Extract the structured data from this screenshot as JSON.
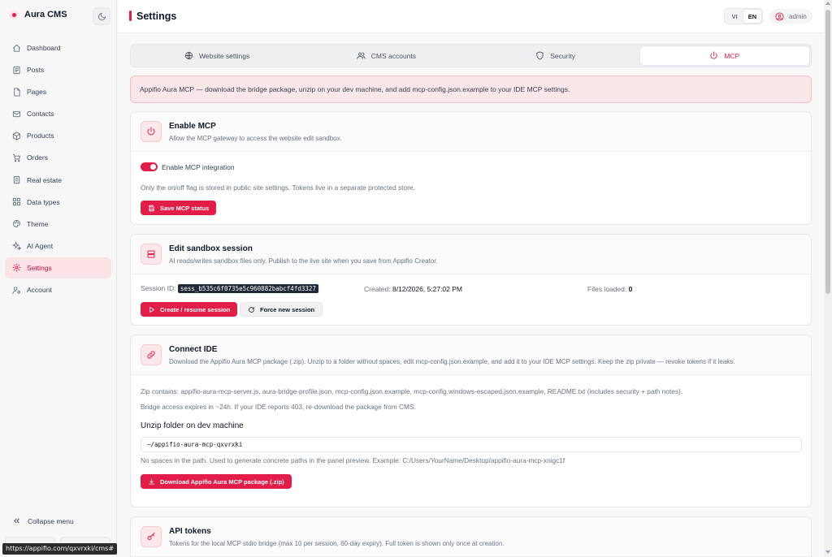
{
  "app": {
    "name": "Aura CMS"
  },
  "sidebar": {
    "items": [
      {
        "label": "Dashboard",
        "icon": "home-icon"
      },
      {
        "label": "Posts",
        "icon": "document-icon"
      },
      {
        "label": "Pages",
        "icon": "pages-icon"
      },
      {
        "label": "Contacts",
        "icon": "mail-icon"
      },
      {
        "label": "Products",
        "icon": "box-icon"
      },
      {
        "label": "Orders",
        "icon": "cart-icon"
      },
      {
        "label": "Real estate",
        "icon": "building-icon"
      },
      {
        "label": "Data types",
        "icon": "grid-icon"
      },
      {
        "label": "Theme",
        "icon": "palette-icon"
      },
      {
        "label": "AI Agent",
        "icon": "sparkles-icon"
      },
      {
        "label": "Settings",
        "icon": "gear-icon",
        "active": true
      },
      {
        "label": "Account",
        "icon": "user-cog-icon"
      }
    ],
    "collapse_label": "Collapse menu"
  },
  "status_bar": {
    "url": "https://appifio.com/qxvrxki/cms#"
  },
  "header": {
    "title": "Settings",
    "languages": [
      "VI",
      "EN"
    ],
    "active_language": "EN",
    "user": "admin"
  },
  "tabs": [
    {
      "label": "Website settings",
      "icon": "globe-icon"
    },
    {
      "label": "CMS accounts",
      "icon": "users-icon"
    },
    {
      "label": "Security",
      "icon": "shield-icon"
    },
    {
      "label": "MCP",
      "icon": "power-icon",
      "active": true
    }
  ],
  "notice": "Appifio Aura MCP — download the bridge package, unzip on your dev machine, and add mcp-config.json.example to your IDE MCP settings.",
  "enable_mcp": {
    "title": "Enable MCP",
    "subtitle": "Allow the MCP gateway to access the website edit sandbox.",
    "toggle_label": "Enable MCP integration",
    "toggle_on": true,
    "note": "Only the on/off flag is stored in public site settings. Tokens live in a separate protected store.",
    "save_label": "Save MCP status"
  },
  "sandbox": {
    "title": "Edit sandbox session",
    "subtitle": "AI reads/writes sandbox files only. Publish to the live site when you save from Appifio Creator.",
    "session_label": "Session ID:",
    "session_id": "sess_b535c6f0735e5c960882babcf4fd3327",
    "created_label": "Created:",
    "created_value": "8/12/2026, 5:27:02 PM",
    "files_label": "Files loaded:",
    "files_value": "0",
    "create_label": "Create / resume session",
    "force_label": "Force new session"
  },
  "connect_ide": {
    "title": "Connect IDE",
    "subtitle": "Download the Appifio Aura MCP package (.zip). Unzip to a folder without spaces, edit mcp-config.json.example, and add it to your IDE MCP settings. Keep the zip private — revoke tokens if it leaks.",
    "zip_contents": "Zip contains: appifio-aura-mcp-server.js, aura-bridge-profile.json, mcp-config.json.example, mcp-config.windows-escaped.json.example, README.txt (includes security + path notes).",
    "bridge_note": "Bridge access expires in ~24h. If your IDE reports 403, re-download the package from CMS.",
    "folder_label": "Unzip folder on dev machine",
    "folder_value": "~/appifio-aura-mcp-qxvrxki",
    "folder_hint": "No spaces in the path. Used to generate concrete paths in the panel preview. Example: C:/Users/YourName/Desktop/appifio-aura-mcp-xnigc1f",
    "download_label": "Download Appifio Aura MCP package (.zip)"
  },
  "api_tokens": {
    "title": "API tokens",
    "subtitle": "Tokens for the local MCP stdio bridge (max 10 per session, 60-day expiry). Full token is shown only once at creation."
  },
  "colors": {
    "accent": "#e11d48",
    "accent_soft": "#fce7eb",
    "notice_bg": "#fbe7ea"
  }
}
